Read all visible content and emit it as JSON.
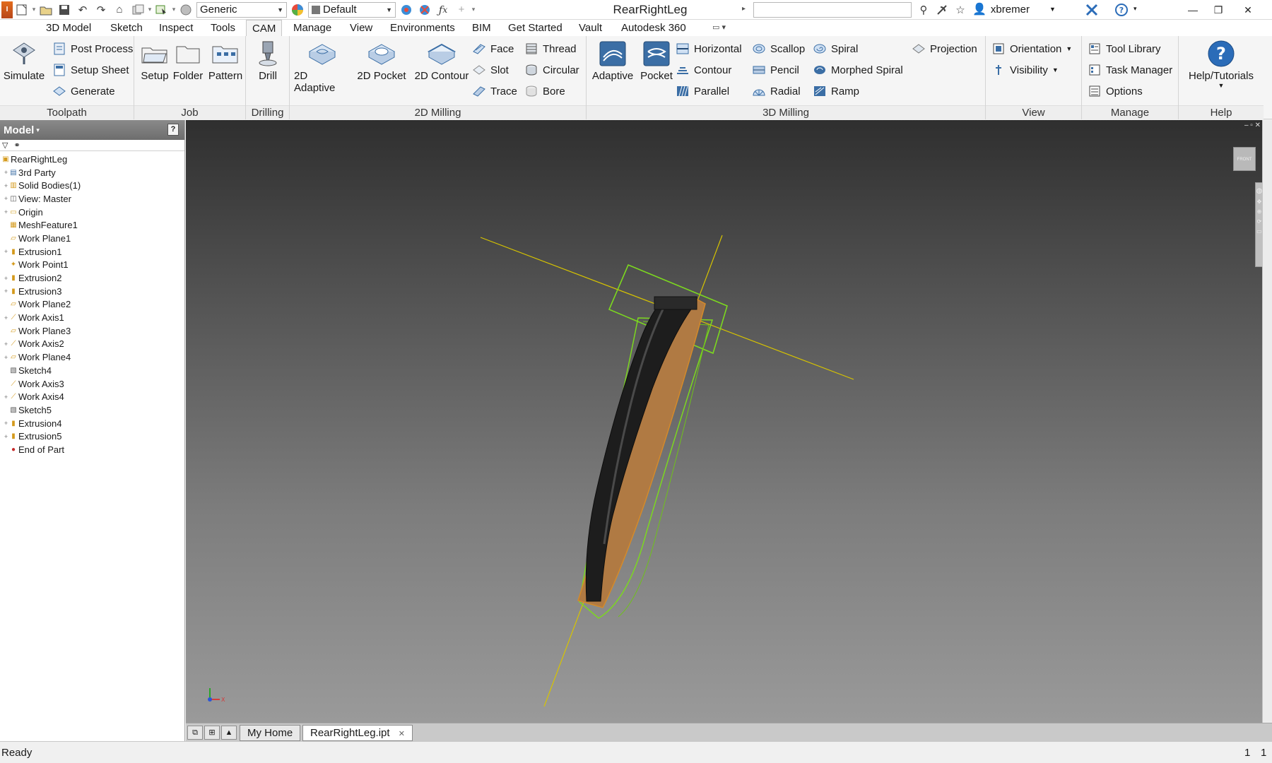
{
  "titlebar": {
    "material": "Generic",
    "appearance": "Default",
    "document_title": "RearRightLeg",
    "user": "xbremer"
  },
  "tabs": [
    "3D Model",
    "Sketch",
    "Inspect",
    "Tools",
    "CAM",
    "Manage",
    "View",
    "Environments",
    "BIM",
    "Get Started",
    "Vault",
    "Autodesk 360"
  ],
  "ribbon": {
    "toolpath": {
      "label": "Toolpath",
      "simulate": "Simulate",
      "post_process": "Post Process",
      "setup_sheet": "Setup Sheet",
      "generate": "Generate"
    },
    "job": {
      "label": "Job",
      "setup": "Setup",
      "folder": "Folder",
      "pattern": "Pattern"
    },
    "drilling": {
      "label": "Drilling",
      "drill": "Drill"
    },
    "milling2d": {
      "label": "2D Milling",
      "adaptive": "2D Adaptive",
      "pocket": "2D Pocket",
      "contour": "2D Contour",
      "face": "Face",
      "slot": "Slot",
      "trace": "Trace",
      "thread": "Thread",
      "circular": "Circular",
      "bore": "Bore"
    },
    "milling3d": {
      "label": "3D Milling",
      "adaptive": "Adaptive",
      "pocket": "Pocket",
      "horizontal": "Horizontal",
      "contour": "Contour",
      "parallel": "Parallel",
      "scallop": "Scallop",
      "pencil": "Pencil",
      "radial": "Radial",
      "spiral": "Spiral",
      "morphed_spiral": "Morphed Spiral",
      "ramp": "Ramp",
      "projection": "Projection"
    },
    "view": {
      "label": "View",
      "orientation": "Orientation",
      "visibility": "Visibility"
    },
    "manage": {
      "label": "Manage",
      "tool_library": "Tool Library",
      "task_manager": "Task Manager",
      "options": "Options"
    },
    "help": {
      "label": "Help",
      "help_tutorials": "Help/Tutorials"
    }
  },
  "browser": {
    "title": "Model",
    "items": [
      {
        "label": "RearRightLeg",
        "icon": "part-icon",
        "expand": ""
      },
      {
        "label": "3rd Party",
        "icon": "third-party-icon",
        "expand": "+"
      },
      {
        "label": "Solid Bodies(1)",
        "icon": "solid-bodies-icon",
        "expand": "+"
      },
      {
        "label": "View: Master",
        "icon": "view-icon",
        "expand": "+"
      },
      {
        "label": "Origin",
        "icon": "folder-icon",
        "expand": "+"
      },
      {
        "label": "MeshFeature1",
        "icon": "mesh-icon",
        "expand": ""
      },
      {
        "label": "Work Plane1",
        "icon": "work-plane-icon",
        "expand": ""
      },
      {
        "label": "Extrusion1",
        "icon": "extrusion-icon",
        "expand": "+"
      },
      {
        "label": "Work Point1",
        "icon": "work-point-icon",
        "expand": ""
      },
      {
        "label": "Extrusion2",
        "icon": "extrusion-icon",
        "expand": "+"
      },
      {
        "label": "Extrusion3",
        "icon": "extrusion-icon",
        "expand": "+"
      },
      {
        "label": "Work Plane2",
        "icon": "work-plane-icon",
        "expand": ""
      },
      {
        "label": "Work Axis1",
        "icon": "work-axis-icon",
        "expand": "+"
      },
      {
        "label": "Work Plane3",
        "icon": "work-plane-icon",
        "expand": ""
      },
      {
        "label": "Work Axis2",
        "icon": "work-axis-icon",
        "expand": "+"
      },
      {
        "label": "Work Plane4",
        "icon": "work-plane-icon",
        "expand": "+"
      },
      {
        "label": "Sketch4",
        "icon": "sketch-icon",
        "expand": ""
      },
      {
        "label": "Work Axis3",
        "icon": "work-axis-icon",
        "expand": ""
      },
      {
        "label": "Work Axis4",
        "icon": "work-axis-icon",
        "expand": "+"
      },
      {
        "label": "Sketch5",
        "icon": "sketch-icon",
        "expand": ""
      },
      {
        "label": "Extrusion4",
        "icon": "extrusion-icon",
        "expand": "+"
      },
      {
        "label": "Extrusion5",
        "icon": "extrusion-icon",
        "expand": "+"
      },
      {
        "label": "End of Part",
        "icon": "end-of-part-icon",
        "expand": ""
      }
    ]
  },
  "viewport": {
    "viewcube_face": "FRONT",
    "triad_x_label": "X"
  },
  "doc_tabs": {
    "home": "My Home",
    "active": "RearRightLeg.ipt"
  },
  "status": {
    "text": "Ready",
    "count_a": "1",
    "count_b": "1"
  },
  "colors": {
    "accent": "#2b6cb8",
    "stock_box": "#7cd81f",
    "work_axis": "#d7c400",
    "leg_body": "#1d1d1d",
    "leg_wood": "#b07a43"
  }
}
